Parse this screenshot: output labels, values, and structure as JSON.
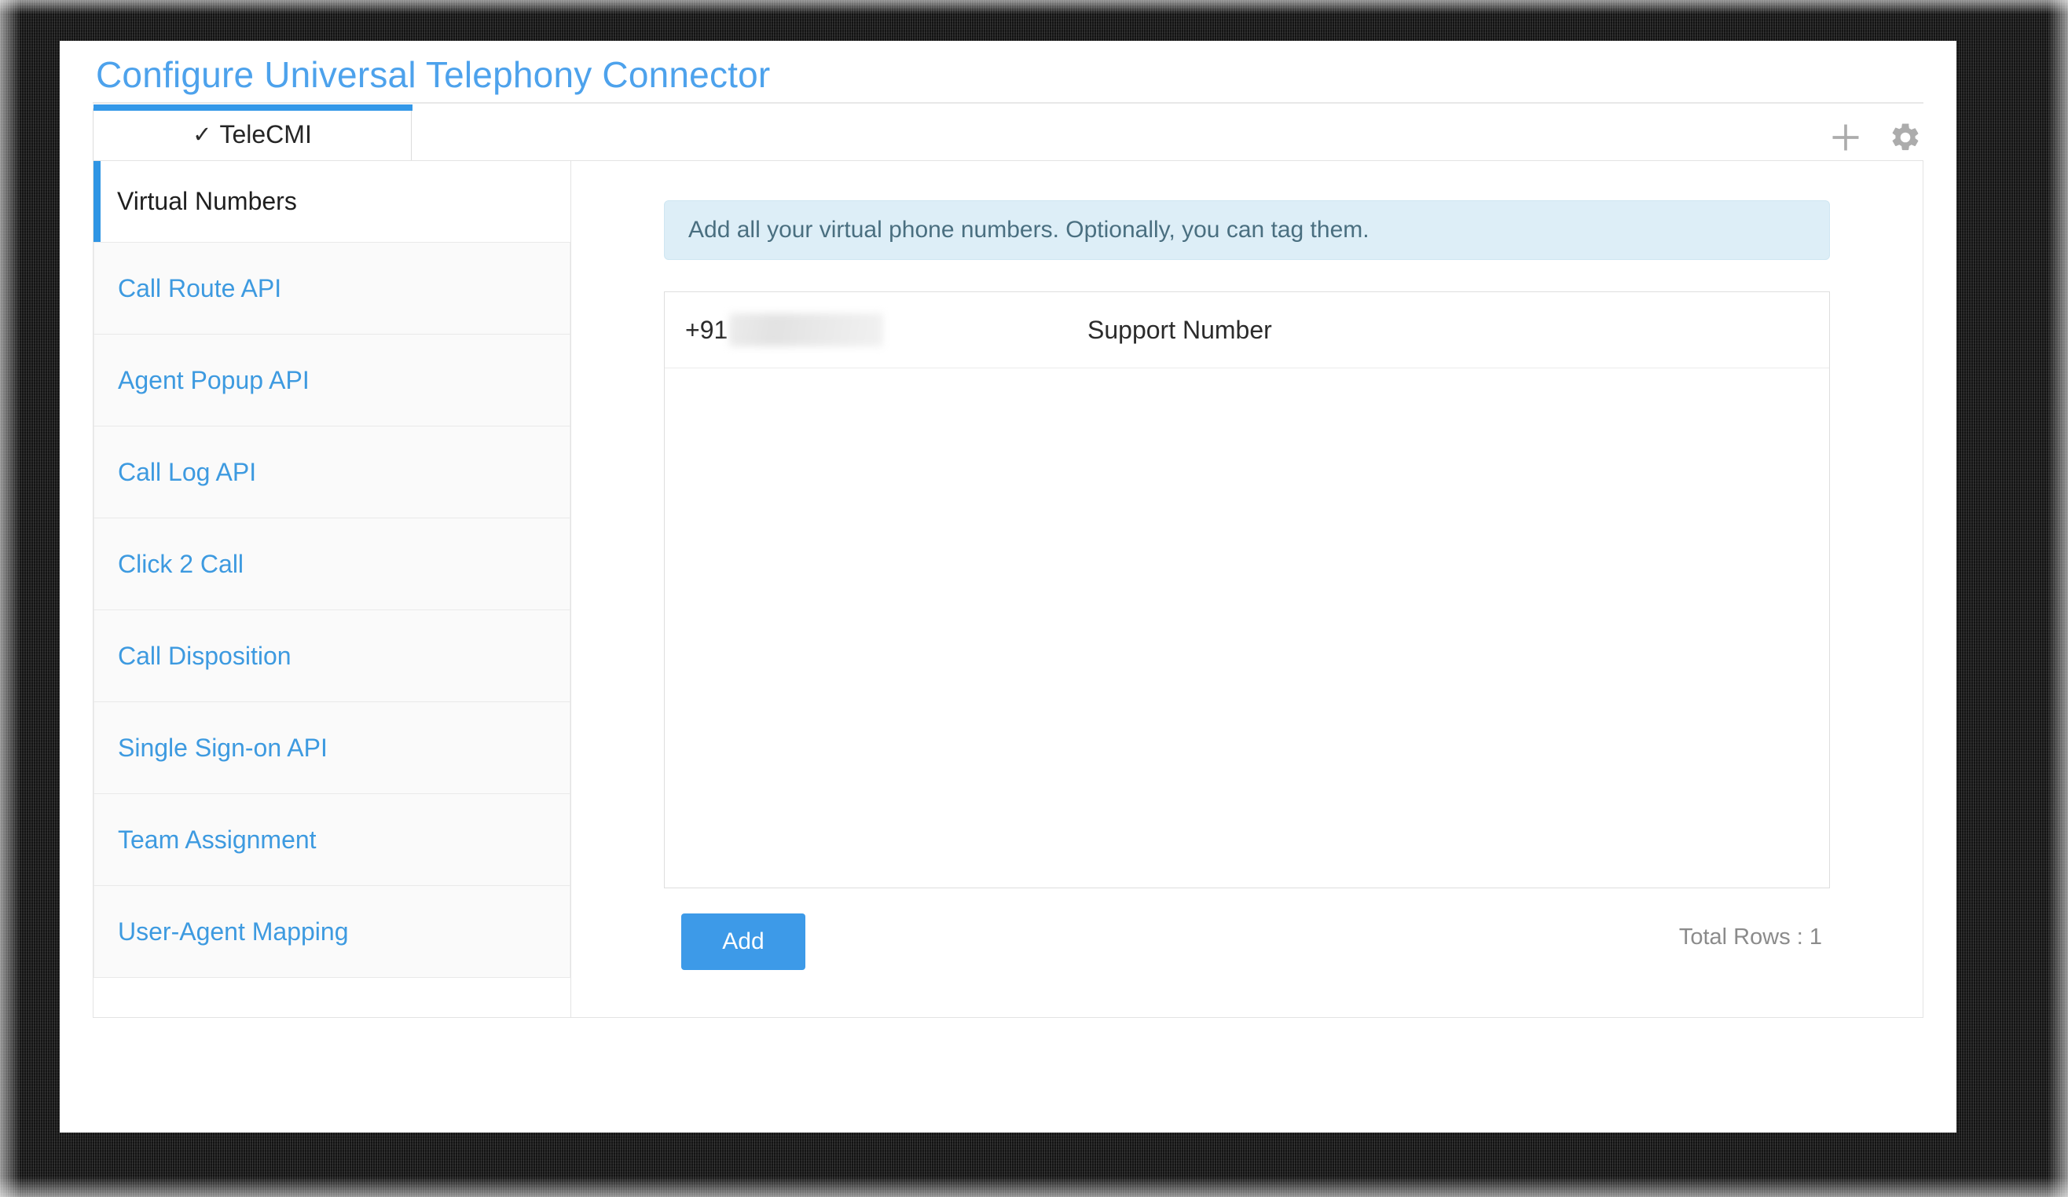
{
  "page": {
    "title": "Configure Universal Telephony Connector"
  },
  "tabs": {
    "active": {
      "label": "TeleCMI",
      "check_glyph": "✓"
    },
    "actions": [
      {
        "name": "add-tab-icon",
        "title": "Add"
      },
      {
        "name": "settings-gear-icon",
        "title": "Settings"
      }
    ]
  },
  "sidebar": {
    "items": [
      {
        "label": "Virtual Numbers",
        "active": true
      },
      {
        "label": "Call Route API",
        "active": false
      },
      {
        "label": "Agent Popup API",
        "active": false
      },
      {
        "label": "Call Log API",
        "active": false
      },
      {
        "label": "Click 2 Call",
        "active": false
      },
      {
        "label": "Call Disposition",
        "active": false
      },
      {
        "label": "Single Sign-on API",
        "active": false
      },
      {
        "label": "Team Assignment",
        "active": false
      },
      {
        "label": "User-Agent Mapping",
        "active": false
      }
    ]
  },
  "content": {
    "info_banner": "Add all your virtual phone numbers. Optionally, you can tag them.",
    "table": {
      "rows": [
        {
          "number_prefix": "+91",
          "number_masked": true,
          "tag": "Support Number"
        }
      ]
    },
    "footer": {
      "add_label": "Add",
      "total_rows": "Total Rows : 1"
    }
  },
  "colors": {
    "accent_blue": "#3d9ae8",
    "title_blue": "#4da2ec",
    "banner_bg": "#ddeef7",
    "tab_accent": "#3498e8"
  }
}
